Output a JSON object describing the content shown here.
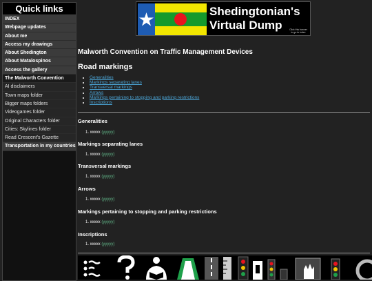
{
  "sidebar": {
    "title": "Quick links",
    "items": [
      {
        "label": "INDEX"
      },
      {
        "label": "Webpage updates"
      },
      {
        "label": "About me"
      },
      {
        "label": "Access my drawings"
      },
      {
        "label": "About Shedington"
      },
      {
        "label": "About Matalospinos"
      },
      {
        "label": "Access the gallery"
      },
      {
        "label": "The Malworth Convention"
      },
      {
        "label": "AI disclaimers"
      },
      {
        "label": "Town maps folder"
      },
      {
        "label": "Bigger maps folders"
      },
      {
        "label": "Videogames folder"
      },
      {
        "label": "Original Characters folder"
      },
      {
        "label": "Cities: Skylines folder"
      },
      {
        "label": "Read Crescent's Gazette"
      },
      {
        "label": "Transportation in my countries"
      }
    ]
  },
  "banner": {
    "title_line1": "Shedingtonian's",
    "title_line2": "Virtual Dump",
    "hint": "Click this banner to go to index",
    "flag_colors": {
      "blue": "#1e5cb3",
      "yellow": "#f2e600",
      "green": "#149a2c",
      "red": "#e8141e"
    }
  },
  "main": {
    "title": "Malworth Convention on Traffic Management Devices",
    "subtitle": "Road markings",
    "toc": [
      "Generalities",
      "Markings separating lanes",
      "Transversal markings",
      "Arrows",
      "Markings pertaining to stopping and parking restrictions",
      "Inscriptions"
    ],
    "sections": [
      {
        "heading": "Generalities",
        "item": "xxxxx",
        "note": "(yyyyy)"
      },
      {
        "heading": "Markings separating lanes",
        "item": "xxxxx",
        "note": "(yyyyy)"
      },
      {
        "heading": "Transversal markings",
        "item": "xxxxx",
        "note": "(yyyyy)"
      },
      {
        "heading": "Arrows",
        "item": "xxxxx",
        "note": "(yyyyy)"
      },
      {
        "heading": "Markings pertaining to stopping and parking restrictions",
        "item": "xxxxx",
        "note": "(yyyyy)"
      },
      {
        "heading": "Inscriptions",
        "item": "xxxxx",
        "note": "(yyyyy)"
      }
    ]
  },
  "icons": [
    "list-icon",
    "question-mark-icon",
    "reading-person-icon",
    "road-icon",
    "roadway-icon",
    "ruler-icon",
    "traffic-light-icon",
    "info-sign-icon",
    "stop-hand-icon",
    "traffic-signal-icon",
    "roundabout-icon"
  ],
  "colors": {
    "background": "#222222",
    "link": "#4aa3d4",
    "note": "#63b88a"
  }
}
